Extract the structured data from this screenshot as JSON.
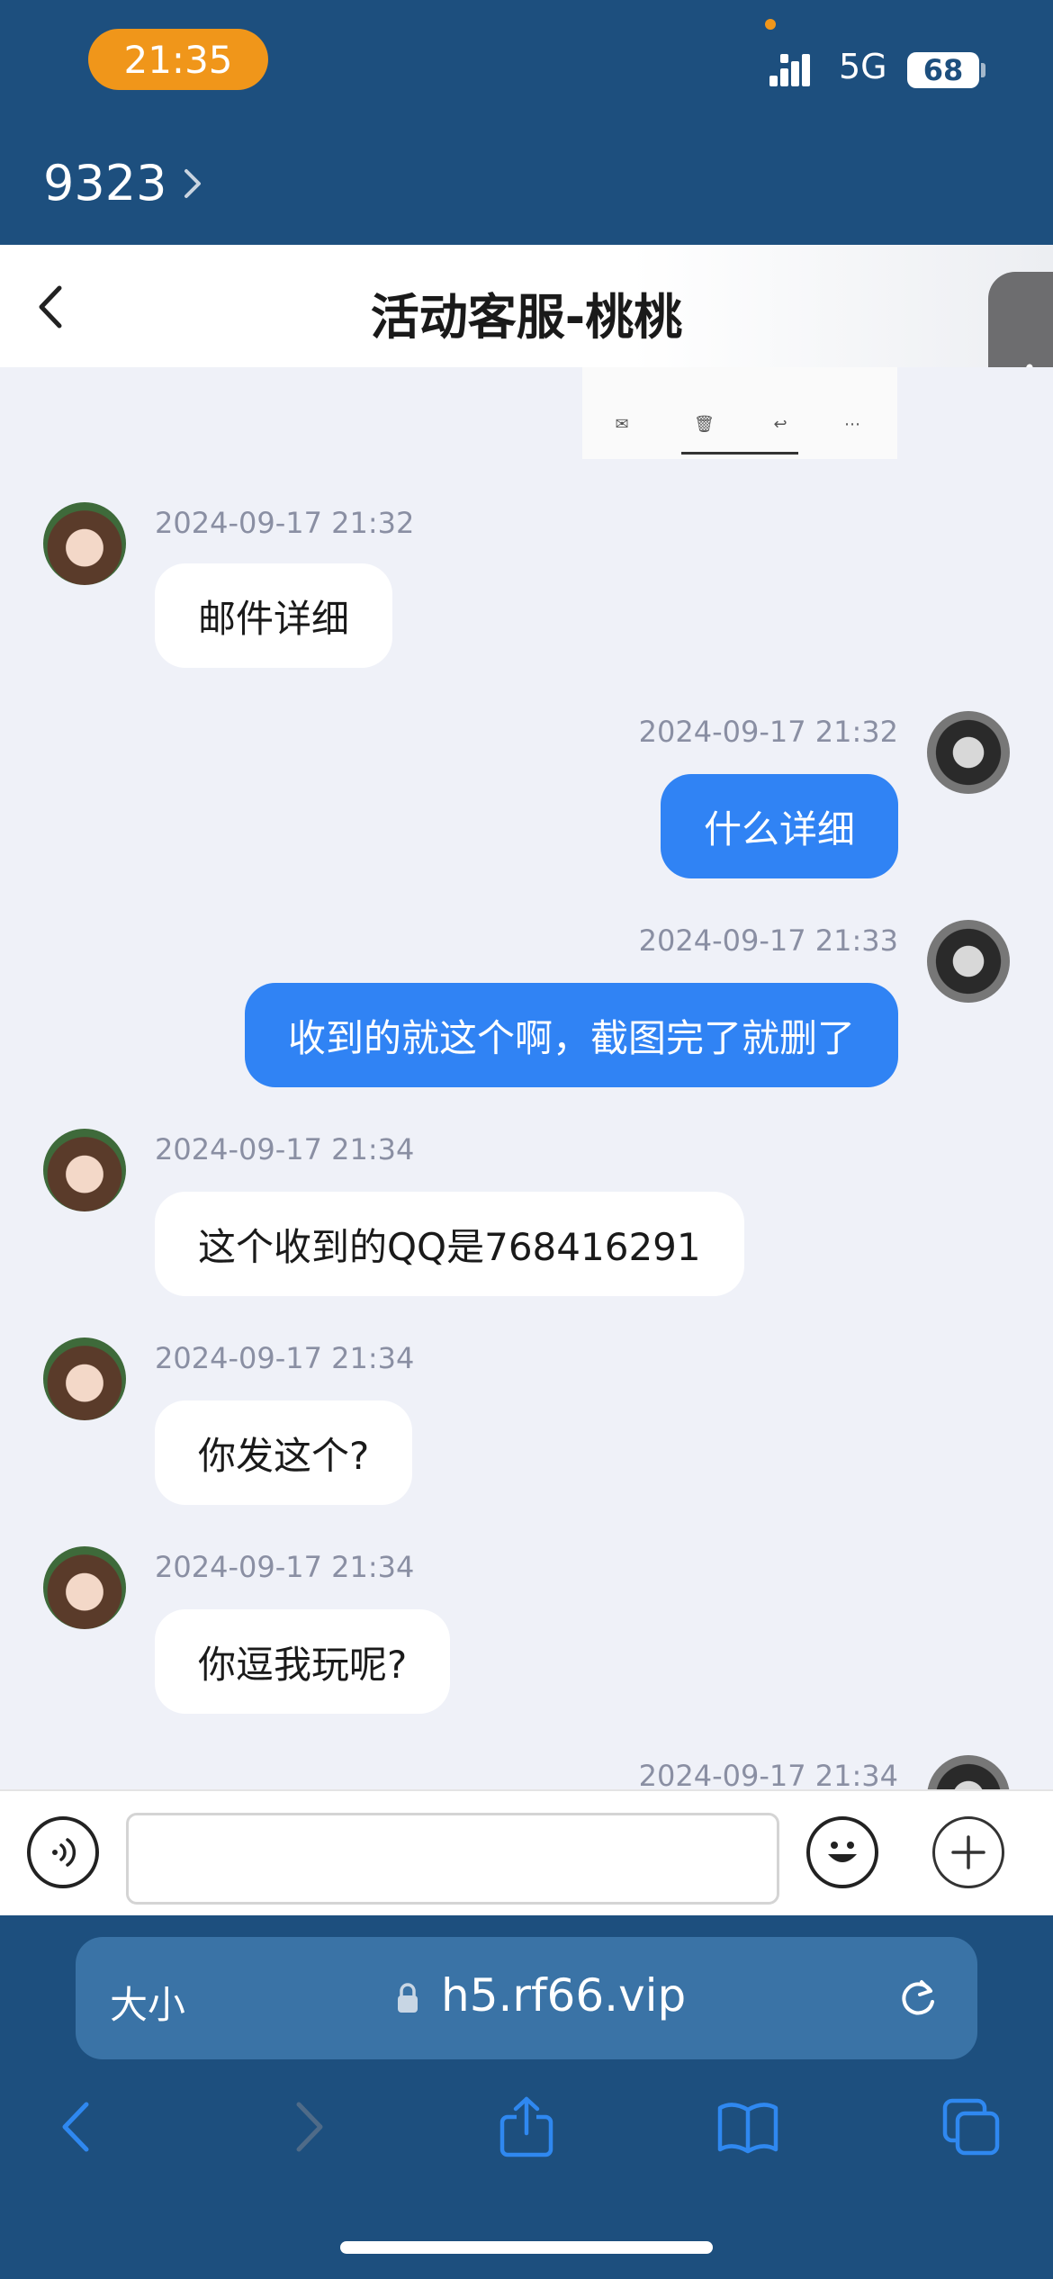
{
  "status_bar": {
    "time": "21:35",
    "network": "5G",
    "battery": "68"
  },
  "app_back": {
    "label": "9323"
  },
  "chat": {
    "title": "活动客服-桃桃"
  },
  "messages": [
    {
      "side": "in",
      "timestamp": "2024-09-17 21:32",
      "text": "邮件详细"
    },
    {
      "side": "out",
      "timestamp": "2024-09-17 21:32",
      "text": "什么详细"
    },
    {
      "side": "out",
      "timestamp": "2024-09-17 21:33",
      "text": "收到的就这个啊，截图完了就删了"
    },
    {
      "side": "in",
      "timestamp": "2024-09-17 21:34",
      "text": "这个收到的QQ是768416291"
    },
    {
      "side": "in",
      "timestamp": "2024-09-17 21:34",
      "text": "你发这个?"
    },
    {
      "side": "in",
      "timestamp": "2024-09-17 21:34",
      "text": "你逗我玩呢?"
    },
    {
      "side": "out",
      "timestamp": "2024-09-17 21:34",
      "text": ""
    }
  ],
  "input": {
    "value": "",
    "placeholder": ""
  },
  "browser": {
    "text_size_label": "大小",
    "url": "h5.rf66.vip"
  },
  "icons": {
    "voice": "voice-icon",
    "emoji": "emoji-icon",
    "plus": "plus-icon",
    "lock": "lock-icon",
    "reload": "reload-icon",
    "back": "back-arrow-icon",
    "forward": "forward-arrow-icon",
    "share": "share-icon",
    "bookmarks": "book-icon",
    "tabs": "tabs-icon"
  },
  "colors": {
    "chrome": "#1d4f7e",
    "outgoing_bubble": "#3083f4",
    "incoming_bubble": "#ffffff",
    "chat_background": "#eff1f8",
    "time_pill": "#f0961a"
  }
}
